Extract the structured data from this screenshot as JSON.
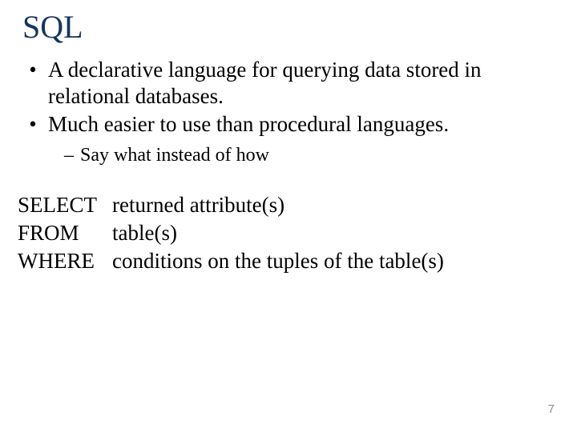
{
  "title": "SQL",
  "bullet1": "A declarative language for querying data stored in relational databases.",
  "bullet2": "Much easier to use than procedural languages.",
  "sub1": "Say what instead of how",
  "sql": {
    "select_kw": "SELECT",
    "select_val": "returned attribute(s)",
    "from_kw": "FROM",
    "from_val": "table(s)",
    "where_kw": "WHERE",
    "where_val": "conditions on the tuples of  the table(s)"
  },
  "page_number": "7",
  "markers": {
    "bullet": "•",
    "dash": "–"
  }
}
